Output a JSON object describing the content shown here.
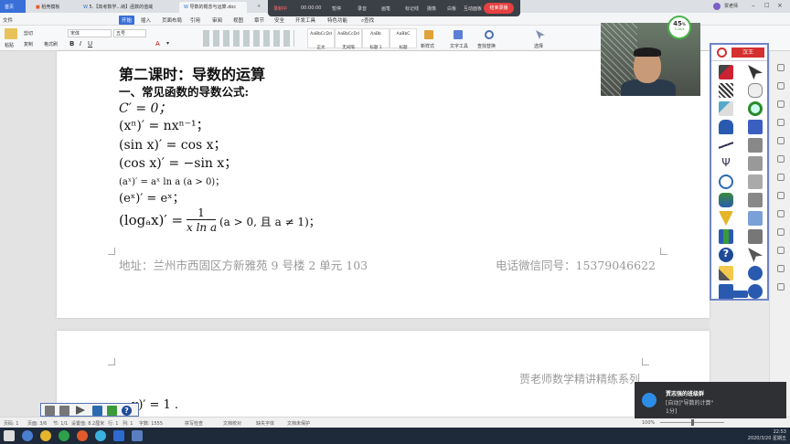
{
  "tabs": [
    {
      "label": "首页"
    },
    {
      "label": "稻壳模板"
    },
    {
      "label": "5.【高考数学...纳】函数的值域"
    },
    {
      "label": "导数的概念与运算.doc"
    }
  ],
  "recorder": {
    "status": "录制中",
    "time": "00:00:00",
    "items": [
      "暂停",
      "录音",
      "画笔",
      "标记线",
      "摄像",
      "白板",
      "互动面板"
    ],
    "stop_label": "结束录播"
  },
  "menu": [
    "文件",
    "开始",
    "插入",
    "页面布局",
    "引用",
    "审阅",
    "视图",
    "章节",
    "安全",
    "开发工具",
    "特色功能",
    "查找"
  ],
  "ribbon": {
    "font_name": "宋体",
    "font_size": "五号",
    "labels": [
      "粘贴",
      "剪切",
      "复制",
      "格式刷"
    ],
    "styles": [
      {
        "sample": "AaBbCcDd",
        "label": "正文"
      },
      {
        "sample": "AaBbCcDd",
        "label": "无间隔"
      },
      {
        "sample": "AaBb",
        "label": "标题 1"
      },
      {
        "sample": "AaBbC",
        "label": "标题"
      }
    ],
    "right_tools": [
      "新样式",
      "文字工具",
      "查找替换",
      "选择"
    ]
  },
  "document": {
    "heading": "第二课时：导数的运算",
    "subheading": "一、常见函数的导数公式:",
    "formulas": [
      "C′ = 0；",
      "(xⁿ)′ = nxⁿ⁻¹；",
      "(sin x)′ = cos x；",
      "(cos x)′ = −sin x；",
      "(aˣ)′ = aˣ ln a (a > 0)；",
      "(eˣ)′ = eˣ；"
    ],
    "log_lhs": "(logₐx)′ =",
    "log_num": "1",
    "log_den": "x ln a",
    "log_cond": "(a > 0, 且 a ≠ 1)；",
    "footer_address": "地址：兰州市西固区方新雅苑 9 号楼 2 单元 103",
    "footer_phone": "电话微信同号：15379046622",
    "page2_header": "贾老师数学精讲精练系列",
    "page2_partial": "x)′ = 1 ."
  },
  "speed": {
    "percent": "45",
    "unit": "%",
    "rate": "0.1K/s"
  },
  "tool_brand": "汉王",
  "status": {
    "page": "页码: 1",
    "pages": "页面: 3/6",
    "section": "节: 1/1",
    "position": "设置值: 8.2厘米",
    "row": "行: 1",
    "col": "列: 1",
    "words": "字数: 1555",
    "spell": "拼写检查",
    "compare": "文档校对",
    "missing_font": "缺失字体",
    "protect": "文档未保护",
    "zoom": "100%"
  },
  "notification": {
    "title": "贾志强的班级群",
    "line1": "[自动]\"导数的计算\"",
    "line2": "1分]"
  },
  "clock": {
    "time": "22:53",
    "date": "2020/3/20 星期五"
  }
}
